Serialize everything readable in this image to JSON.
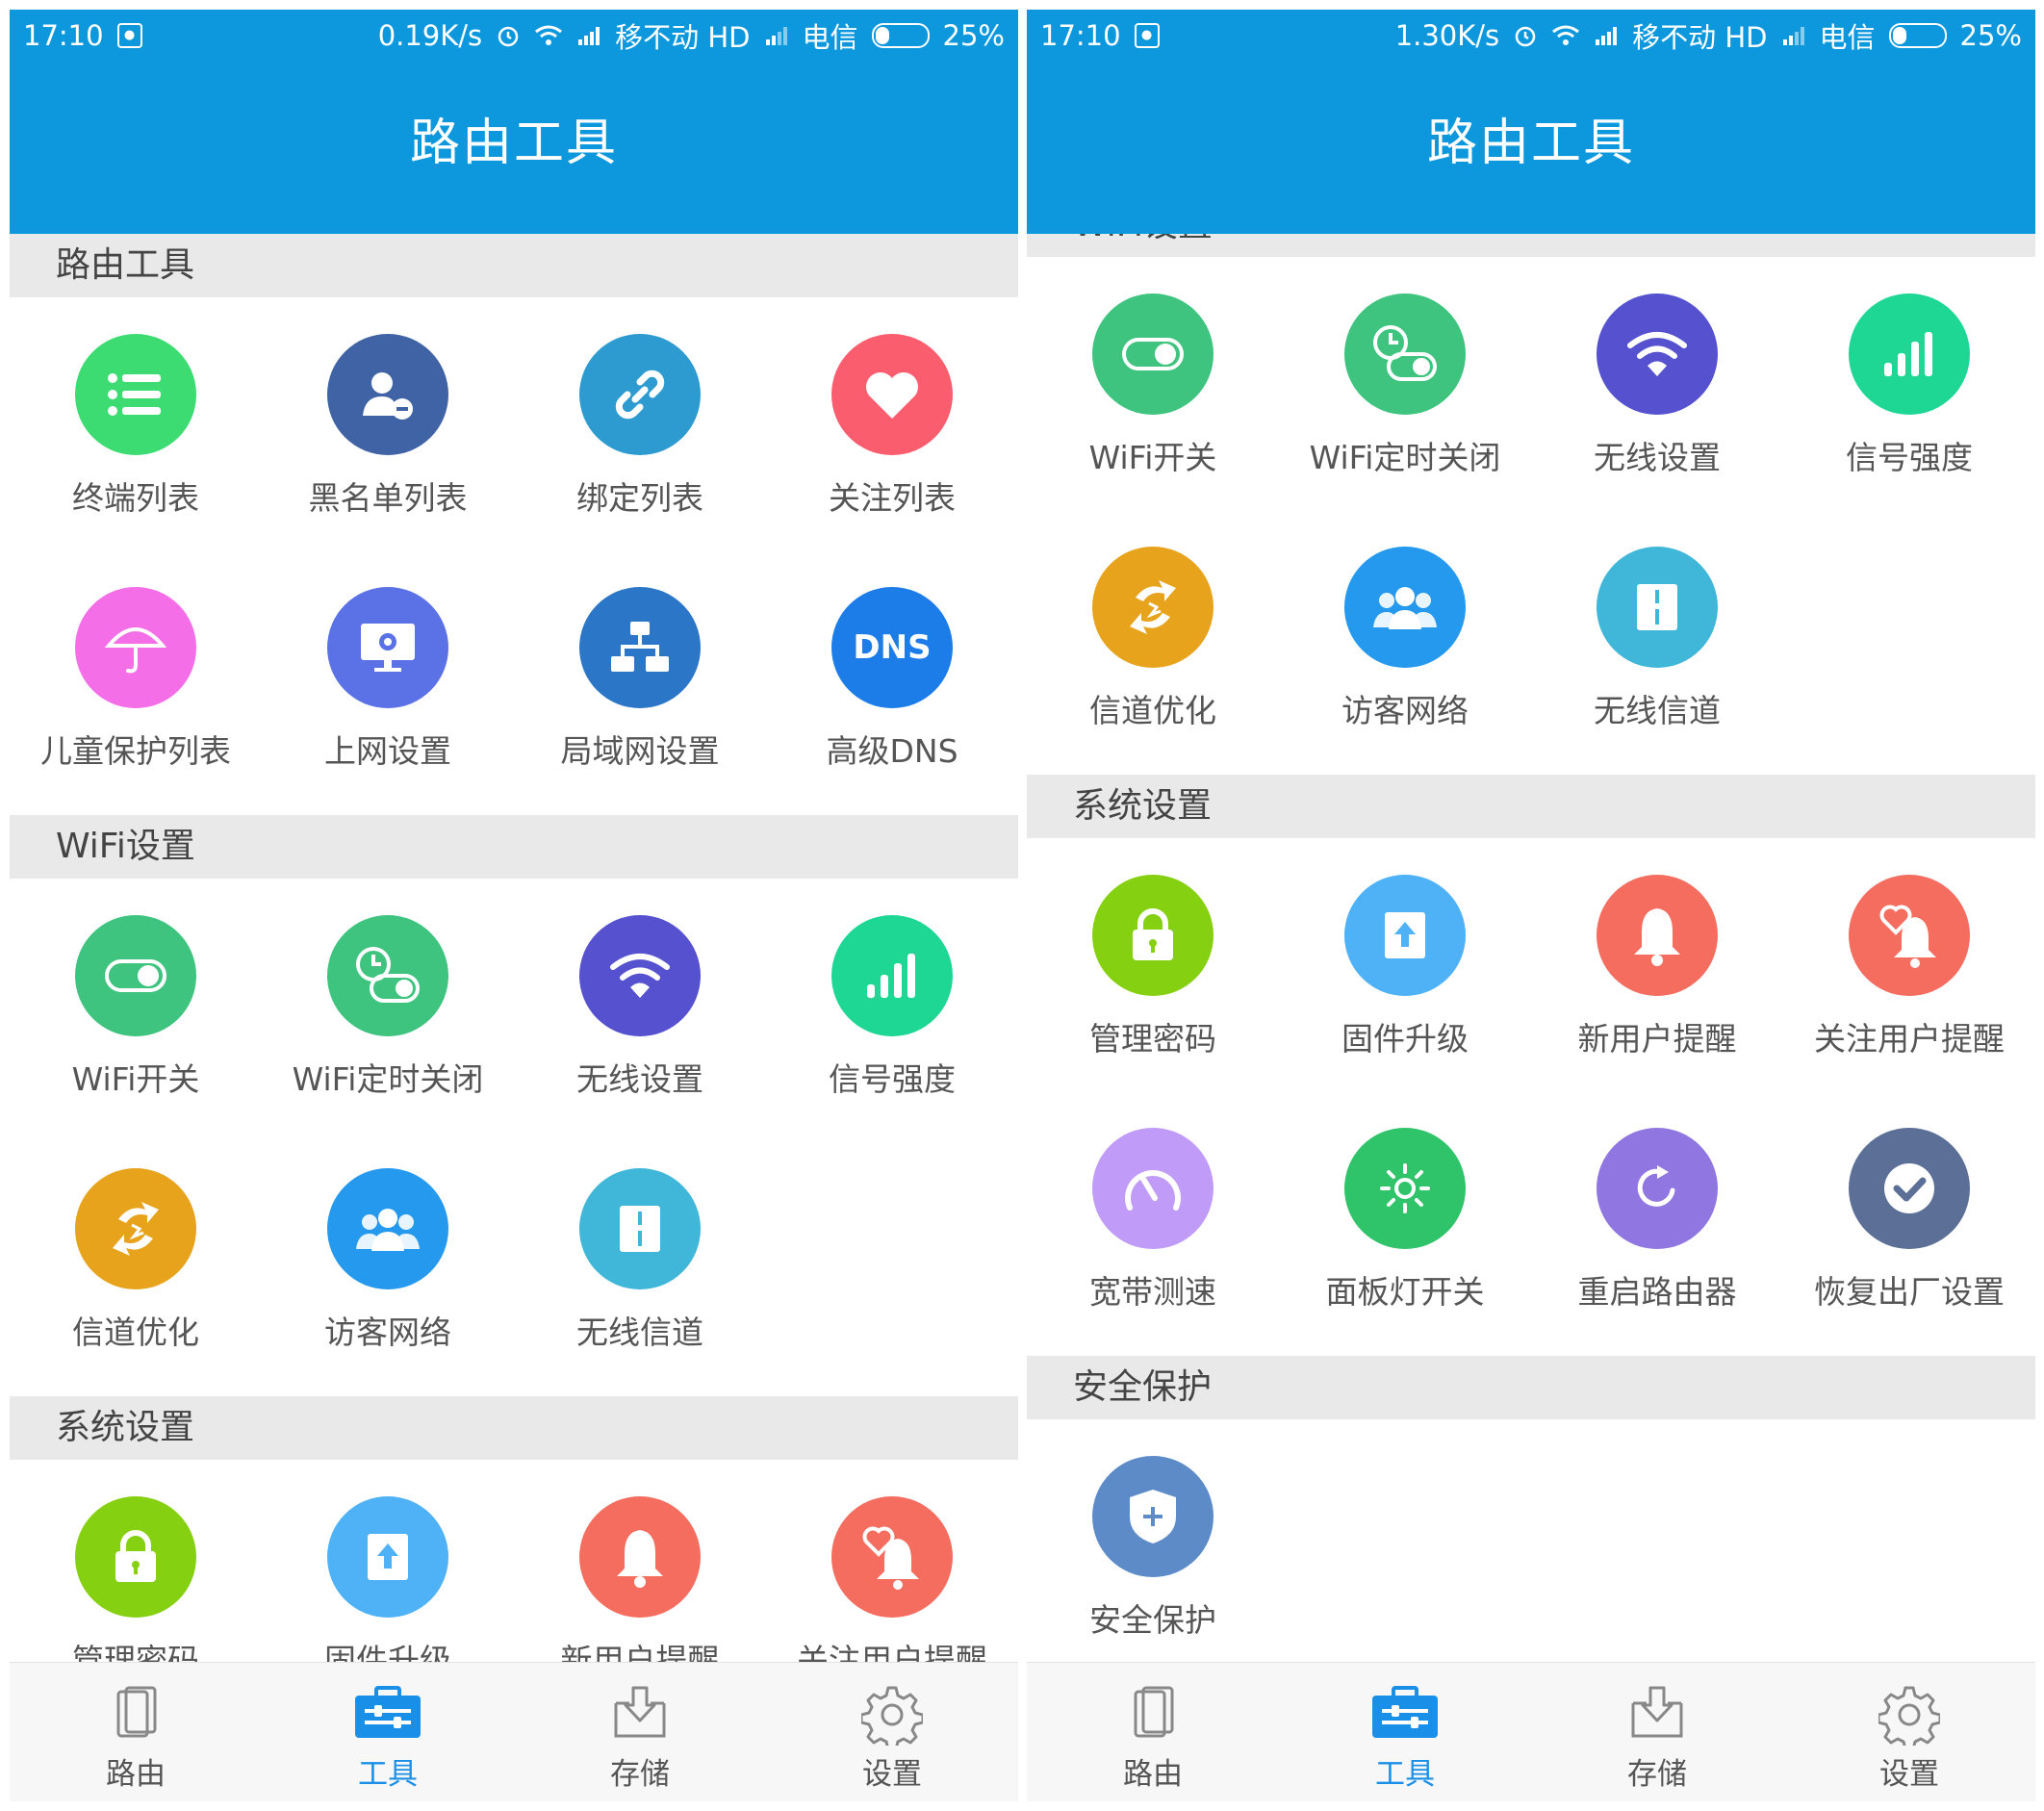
{
  "colors": {
    "app_bar": "#0d98de",
    "section_bg": "#e9e9e9",
    "active_nav": "#1a8fe8"
  },
  "screens": [
    {
      "status": {
        "time": "17:10",
        "speed": "0.19K/s",
        "carrier1": "移不动 HD",
        "carrier2": "电信",
        "battery": "25%"
      },
      "title": "路由工具",
      "sections": [
        {
          "header": "路由工具",
          "items": [
            {
              "label": "终端列表",
              "icon": "list-icon",
              "color": "#3ddc72"
            },
            {
              "label": "黑名单列表",
              "icon": "user-block-icon",
              "color": "#3f63a4"
            },
            {
              "label": "绑定列表",
              "icon": "link-icon",
              "color": "#2d9bd0"
            },
            {
              "label": "关注列表",
              "icon": "heart-icon",
              "color": "#fa5d6e"
            },
            {
              "label": "儿童保护列表",
              "icon": "umbrella-icon",
              "color": "#f46ee8"
            },
            {
              "label": "上网设置",
              "icon": "monitor-gear-icon",
              "color": "#5a72e5"
            },
            {
              "label": "局域网设置",
              "icon": "network-icon",
              "color": "#2c76c8"
            },
            {
              "label": "高级DNS",
              "icon": "dns-icon",
              "color": "#1c7de8",
              "text": "DNS"
            }
          ]
        },
        {
          "header": "WiFi设置",
          "items": [
            {
              "label": "WiFi开关",
              "icon": "toggle-icon",
              "color": "#3ec47f"
            },
            {
              "label": "WiFi定时关闭",
              "icon": "timer-toggle-icon",
              "color": "#3ec47f"
            },
            {
              "label": "无线设置",
              "icon": "wifi-icon",
              "color": "#5551cf"
            },
            {
              "label": "信号强度",
              "icon": "signal-bars-icon",
              "color": "#1fd795"
            },
            {
              "label": "信道优化",
              "icon": "channel-optimize-icon",
              "color": "#e8a31c"
            },
            {
              "label": "访客网络",
              "icon": "guests-icon",
              "color": "#2599ed"
            },
            {
              "label": "无线信道",
              "icon": "channel-icon",
              "color": "#40b7d8"
            }
          ]
        },
        {
          "header": "系统设置",
          "items": [
            {
              "label": "管理密码",
              "icon": "lock-icon",
              "color": "#86d012"
            },
            {
              "label": "固件升级",
              "icon": "upgrade-icon",
              "color": "#4fb1f6"
            },
            {
              "label": "新用户提醒",
              "icon": "bell-icon",
              "color": "#f46d5f"
            },
            {
              "label": "关注用户提醒",
              "icon": "heart-bell-icon",
              "color": "#f46d5f"
            }
          ]
        }
      ]
    },
    {
      "status": {
        "time": "17:10",
        "speed": "1.30K/s",
        "carrier1": "移不动 HD",
        "carrier2": "电信",
        "battery": "25%"
      },
      "title": "路由工具",
      "sections": [
        {
          "header": "WiFi设置",
          "items": [
            {
              "label": "WiFi开关",
              "icon": "toggle-icon",
              "color": "#3ec47f"
            },
            {
              "label": "WiFi定时关闭",
              "icon": "timer-toggle-icon",
              "color": "#3ec47f"
            },
            {
              "label": "无线设置",
              "icon": "wifi-icon",
              "color": "#5551cf"
            },
            {
              "label": "信号强度",
              "icon": "signal-bars-icon",
              "color": "#1fd795"
            },
            {
              "label": "信道优化",
              "icon": "channel-optimize-icon",
              "color": "#e8a31c"
            },
            {
              "label": "访客网络",
              "icon": "guests-icon",
              "color": "#2599ed"
            },
            {
              "label": "无线信道",
              "icon": "channel-icon",
              "color": "#40b7d8"
            }
          ]
        },
        {
          "header": "系统设置",
          "items": [
            {
              "label": "管理密码",
              "icon": "lock-icon",
              "color": "#86d012"
            },
            {
              "label": "固件升级",
              "icon": "upgrade-icon",
              "color": "#4fb1f6"
            },
            {
              "label": "新用户提醒",
              "icon": "bell-icon",
              "color": "#f46d5f"
            },
            {
              "label": "关注用户提醒",
              "icon": "heart-bell-icon",
              "color": "#f46d5f"
            },
            {
              "label": "宽带测速",
              "icon": "speedometer-icon",
              "color": "#c09bf7"
            },
            {
              "label": "面板灯开关",
              "icon": "light-icon",
              "color": "#30c46a"
            },
            {
              "label": "重启路由器",
              "icon": "restart-icon",
              "color": "#9076e0"
            },
            {
              "label": "恢复出厂设置",
              "icon": "check-circle-icon",
              "color": "#5b6f97"
            }
          ]
        },
        {
          "header": "安全保护",
          "items": [
            {
              "label": "安全保护",
              "icon": "shield-icon",
              "color": "#5c8bc8"
            }
          ]
        }
      ]
    }
  ],
  "nav": [
    {
      "label": "路由",
      "icon": "router-icon"
    },
    {
      "label": "工具",
      "icon": "toolbox-icon",
      "active": true
    },
    {
      "label": "存储",
      "icon": "download-box-icon"
    },
    {
      "label": "设置",
      "icon": "gear-icon"
    }
  ]
}
